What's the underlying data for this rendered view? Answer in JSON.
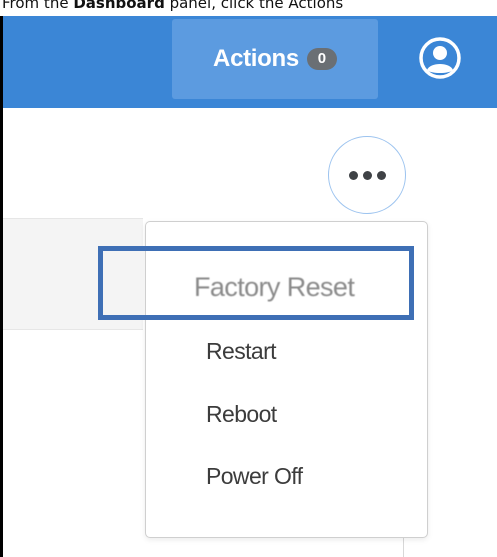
{
  "caption": {
    "pre": "From the ",
    "bold": "Dashboard",
    "post": " panel, click the Actions"
  },
  "header": {
    "actions": {
      "label": "Actions",
      "count": "0"
    },
    "profile_icon": "user-circle-icon"
  },
  "more_button": {
    "icon": "ellipsis-icon"
  },
  "menu": {
    "items": [
      {
        "label": "Factory Reset",
        "highlighted": true
      },
      {
        "label": "Restart"
      },
      {
        "label": "Reboot"
      },
      {
        "label": "Power Off"
      }
    ]
  },
  "colors": {
    "header_bg": "#3b86d6",
    "actions_bg": "#5c9be0",
    "badge_bg": "#6a6f74",
    "highlight_border": "#3e6fb5",
    "more_border": "#9cc3ef"
  }
}
